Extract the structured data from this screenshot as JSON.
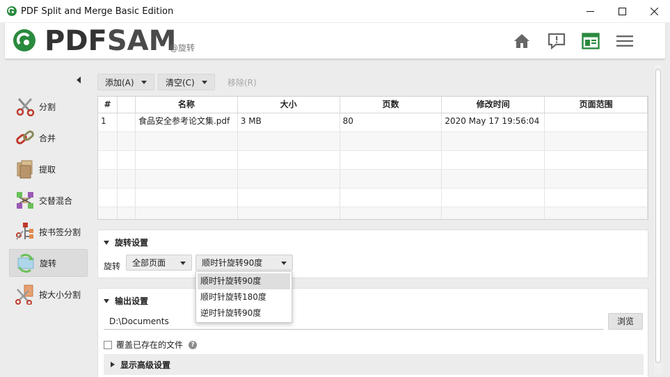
{
  "window": {
    "title": "PDF Split and Merge Basic Edition"
  },
  "header": {
    "logo_pdf": "PDF",
    "logo_sam": "SAM",
    "subtitle": "@旋转",
    "icons": [
      "home-icon",
      "feedback-icon",
      "news-icon",
      "menu-icon"
    ],
    "accent": "#2a8a3e"
  },
  "sidebar": {
    "items": [
      {
        "label": "分割",
        "icon": "scissors-icon"
      },
      {
        "label": "合并",
        "icon": "chain-icon"
      },
      {
        "label": "提取",
        "icon": "pages-icon"
      },
      {
        "label": "交替混合",
        "icon": "mix-icon"
      },
      {
        "label": "按书签分割",
        "icon": "bookmark-split-icon"
      },
      {
        "label": "旋转",
        "icon": "rotate-icon",
        "active": true
      },
      {
        "label": "按大小分割",
        "icon": "size-split-icon"
      }
    ]
  },
  "toolbar": {
    "add_label": "添加(A)",
    "clear_label": "清空(C)",
    "remove_label": "移除(R)"
  },
  "table": {
    "columns": [
      "#",
      "",
      "名称",
      "大小",
      "页数",
      "修改时间",
      "页面范围"
    ],
    "rows": [
      [
        "1",
        "",
        "食品安全参考论文集.pdf",
        "3 MB",
        "80",
        "2020 May 17 19:56:04",
        ""
      ]
    ]
  },
  "rotate_settings": {
    "title": "旋转设置",
    "label": "旋转",
    "pages_value": "全部页面",
    "rotation_value": "顺时针旋转90度",
    "options": [
      "顺时针旋转90度",
      "顺时针旋转180度",
      "逆时针旋转90度"
    ]
  },
  "output_settings": {
    "title": "输出设置",
    "path_value": "D:\\Documents",
    "browse_label": "浏览",
    "overwrite_label": "覆盖已存在的文件",
    "advanced_label": "显示高级设置"
  }
}
